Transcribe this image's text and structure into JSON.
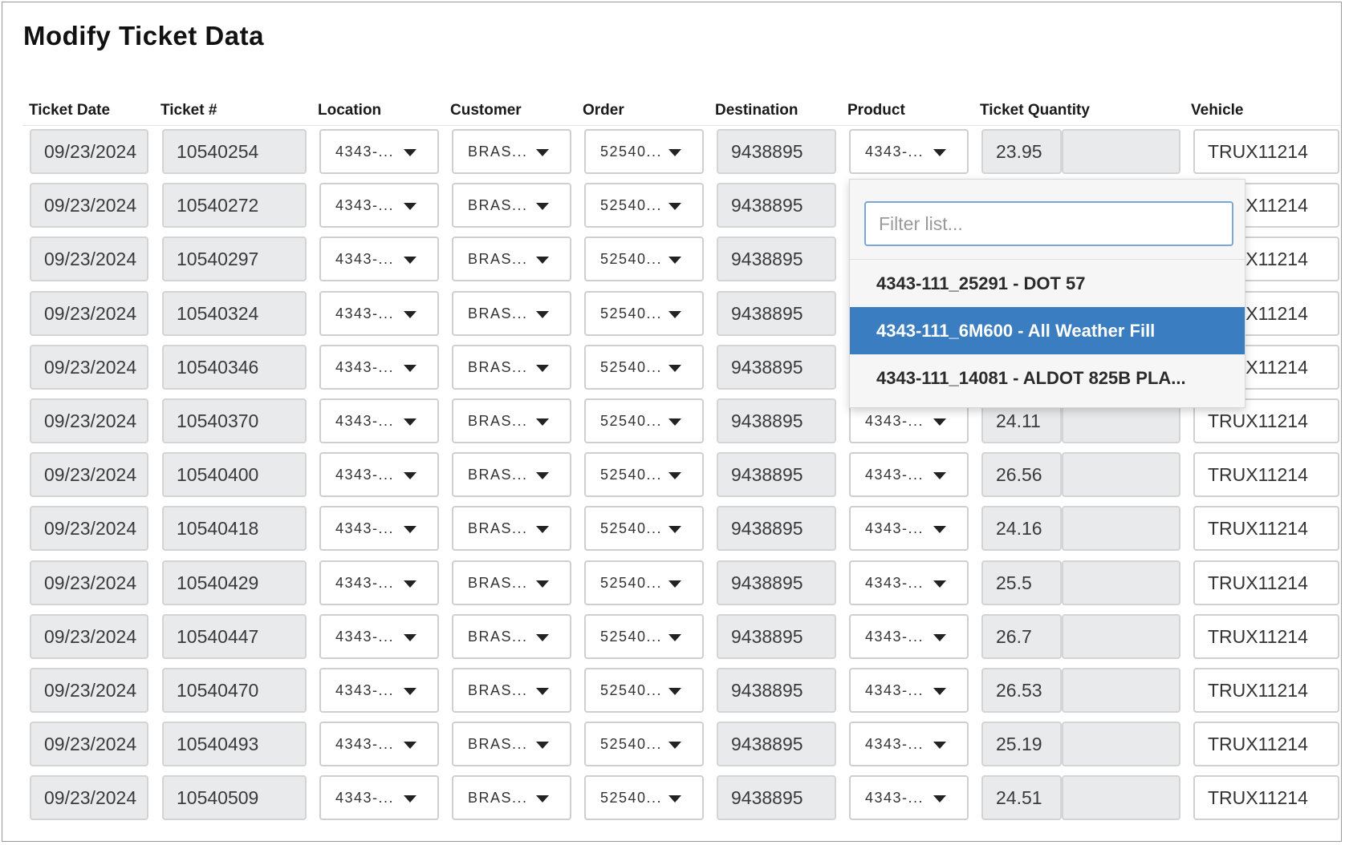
{
  "page": {
    "title": "Modify Ticket Data"
  },
  "columns": [
    "Ticket Date",
    "Ticket #",
    "Location",
    "Customer",
    "Order",
    "Destination",
    "Product",
    "Ticket Quantity",
    "Vehicle"
  ],
  "select_display": {
    "location": "4343-...",
    "customer": "BRAS...",
    "order": "52540...",
    "product": "4343-..."
  },
  "rows": [
    {
      "date": "09/23/2024",
      "ticket": "10540254",
      "destination": "9438895",
      "quantity": "23.95",
      "vehicle": "TRUX11214"
    },
    {
      "date": "09/23/2024",
      "ticket": "10540272",
      "destination": "9438895",
      "quantity": "",
      "vehicle": "TRUX11214"
    },
    {
      "date": "09/23/2024",
      "ticket": "10540297",
      "destination": "9438895",
      "quantity": "",
      "vehicle": "TRUX11214"
    },
    {
      "date": "09/23/2024",
      "ticket": "10540324",
      "destination": "9438895",
      "quantity": "",
      "vehicle": "TRUX11214"
    },
    {
      "date": "09/23/2024",
      "ticket": "10540346",
      "destination": "9438895",
      "quantity": "",
      "vehicle": "TRUX11214"
    },
    {
      "date": "09/23/2024",
      "ticket": "10540370",
      "destination": "9438895",
      "quantity": "24.11",
      "vehicle": "TRUX11214"
    },
    {
      "date": "09/23/2024",
      "ticket": "10540400",
      "destination": "9438895",
      "quantity": "26.56",
      "vehicle": "TRUX11214"
    },
    {
      "date": "09/23/2024",
      "ticket": "10540418",
      "destination": "9438895",
      "quantity": "24.16",
      "vehicle": "TRUX11214"
    },
    {
      "date": "09/23/2024",
      "ticket": "10540429",
      "destination": "9438895",
      "quantity": "25.5",
      "vehicle": "TRUX11214"
    },
    {
      "date": "09/23/2024",
      "ticket": "10540447",
      "destination": "9438895",
      "quantity": "26.7",
      "vehicle": "TRUX11214"
    },
    {
      "date": "09/23/2024",
      "ticket": "10540470",
      "destination": "9438895",
      "quantity": "26.53",
      "vehicle": "TRUX11214"
    },
    {
      "date": "09/23/2024",
      "ticket": "10540493",
      "destination": "9438895",
      "quantity": "25.19",
      "vehicle": "TRUX11214"
    },
    {
      "date": "09/23/2024",
      "ticket": "10540509",
      "destination": "9438895",
      "quantity": "24.51",
      "vehicle": "TRUX11214"
    }
  ],
  "product_dropdown": {
    "filter_placeholder": "Filter list...",
    "filter_value": "",
    "options": [
      {
        "label": "4343-111_25291 - DOT 57",
        "selected": false
      },
      {
        "label": "4343-111_6M600 - All Weather Fill",
        "selected": true
      },
      {
        "label": "4343-111_14081 - ALDOT 825B PLA...",
        "selected": false
      }
    ]
  },
  "colors": {
    "highlight": "#3a7dc0",
    "readonly_bg": "#e9eaec",
    "focus_border": "#7aa6d8"
  }
}
